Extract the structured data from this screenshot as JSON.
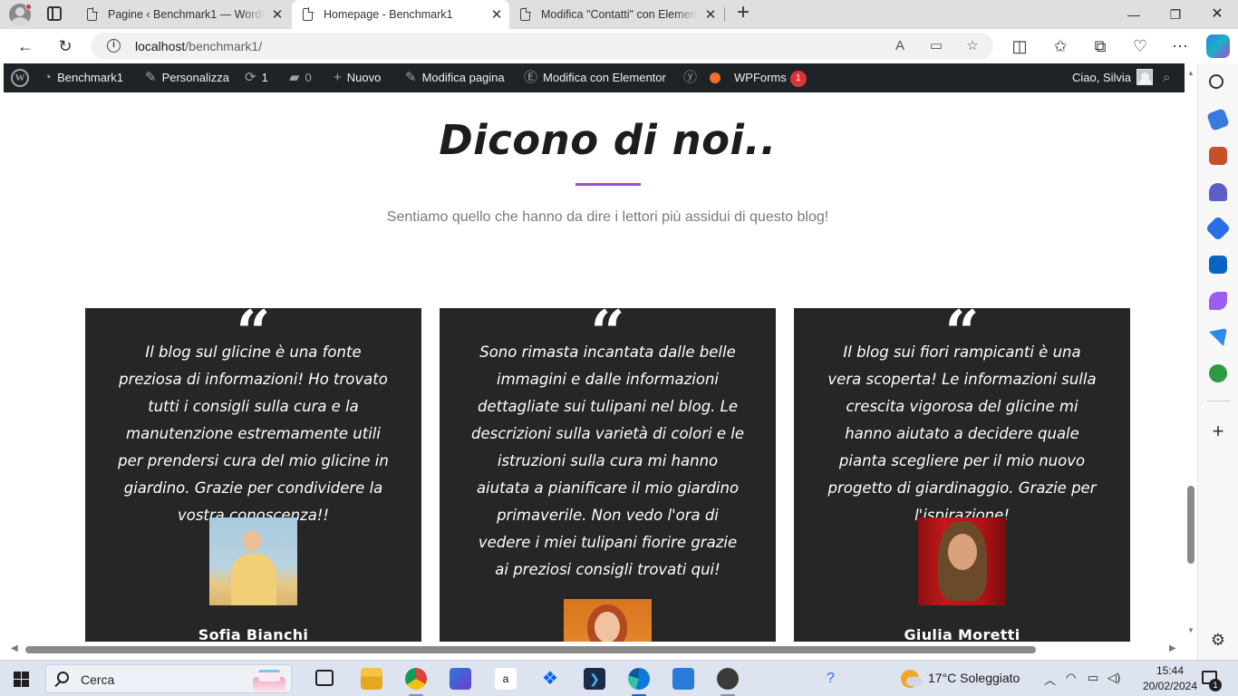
{
  "browser": {
    "tabs": [
      {
        "title": "Pagine ‹ Benchmark1 — WordPress",
        "active": false
      },
      {
        "title": "Homepage - Benchmark1",
        "active": true
      },
      {
        "title": "Modifica \"Contatti\" con Elementor",
        "active": false
      }
    ],
    "address": {
      "host": "localhost",
      "path": "/benchmark1/"
    }
  },
  "wp_admin_bar": {
    "site_name": "Benchmark1",
    "customize": "Personalizza",
    "updates_count": "1",
    "comments_count": "0",
    "new": "Nuovo",
    "edit_page": "Modifica pagina",
    "edit_elementor": "Modifica con Elementor",
    "wpforms": "WPForms",
    "wpforms_badge": "1",
    "greeting": "Ciao, Silvia"
  },
  "page": {
    "heading": "Dicono di noi..",
    "subheading": "Sentiamo quello che hanno da dire i lettori più assidui di questo blog!",
    "accent_color": "#9b4dca",
    "testimonials": [
      {
        "quote": "Il blog sul glicine è una fonte preziosa di informazioni! Ho trovato tutti i consigli sulla cura e la manutenzione estremamente utili per prendersi cura del mio glicine in giardino. Grazie per condividere la vostra conoscenza!!",
        "name": "Sofia Bianchi"
      },
      {
        "quote": "Sono rimasta incantata dalle belle immagini e dalle informazioni dettagliate sui tulipani nel blog. Le descrizioni sulla varietà di colori e le istruzioni sulla cura mi hanno aiutata a pianificare il mio giardino primaverile. Non vedo l'ora di vedere i miei tulipani fiorire grazie ai preziosi consigli trovati qui!",
        "name": ""
      },
      {
        "quote": "Il blog sui fiori rampicanti è una vera scoperta! Le informazioni sulla crescita vigorosa del glicine mi hanno aiutato a decidere quale pianta scegliere per il mio nuovo progetto di giardinaggio. Grazie per l'ispirazione!",
        "name": "Giulia Moretti"
      }
    ]
  },
  "taskbar": {
    "search_placeholder": "Cerca",
    "weather": "17°C  Soleggiato",
    "time": "15:44",
    "date": "20/02/2024",
    "notifications": "1"
  }
}
